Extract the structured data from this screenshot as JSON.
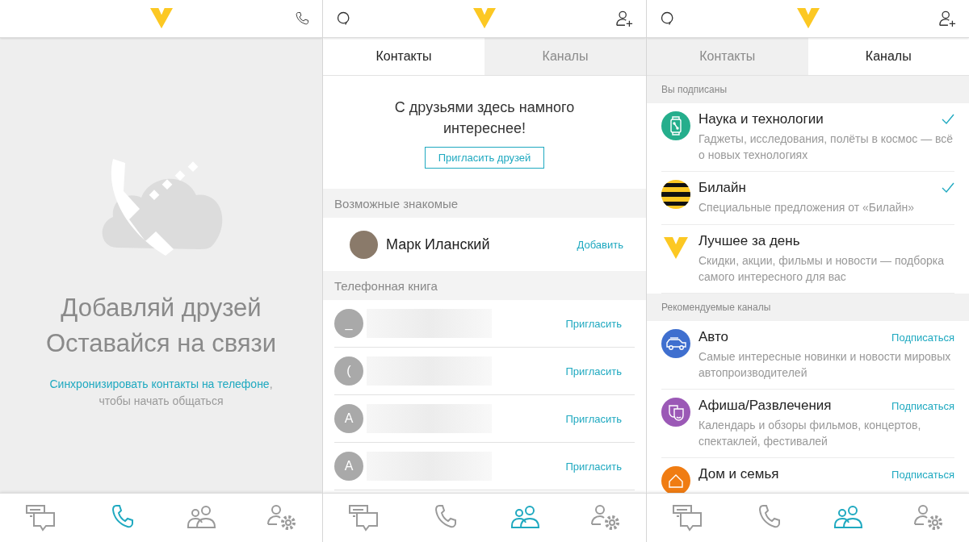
{
  "screens": [
    {
      "kind": "empty",
      "header": {
        "right_actions": [
          {
            "kind": "call"
          }
        ]
      },
      "empty_state": {
        "title_lines": [
          "Добавляй друзей",
          "Оставайся на связи"
        ],
        "link": "Синхронизировать контакты на телефоне",
        "link_suffix": ",",
        "hint": "чтобы начать общаться"
      },
      "nav": [
        {
          "kind": "chats",
          "selected": false
        },
        {
          "kind": "calls",
          "selected": true
        },
        {
          "kind": "contacts",
          "selected": false
        },
        {
          "kind": "settings",
          "selected": false
        }
      ]
    },
    {
      "kind": "contacts",
      "header": {
        "left_actions": [
          {
            "kind": "search"
          }
        ],
        "right_actions": [
          {
            "kind": "add-user"
          }
        ]
      },
      "tabs": [
        {
          "label": "Контакты",
          "selected": true
        },
        {
          "label": "Каналы",
          "selected": false
        }
      ],
      "invite": {
        "text": "С друзьями здесь намного интереснее!",
        "button": "Пригласить друзей"
      },
      "sections": [
        {
          "title": "Возможные знакомые",
          "rows": [
            {
              "kind": "person",
              "name": "Марк Иланский",
              "action": "Добавить"
            }
          ]
        },
        {
          "title": "Телефонная книга",
          "rows": [
            {
              "kind": "phonebook",
              "initial": "_",
              "action": "Пригласить"
            },
            {
              "kind": "phonebook",
              "initial": "(",
              "action": "Пригласить"
            },
            {
              "kind": "phonebook",
              "initial": "A",
              "action": "Пригласить"
            },
            {
              "kind": "phonebook",
              "initial": "A",
              "action": "Пригласить"
            }
          ]
        }
      ],
      "nav": [
        {
          "kind": "chats",
          "selected": false
        },
        {
          "kind": "calls",
          "selected": false
        },
        {
          "kind": "contacts",
          "selected": true
        },
        {
          "kind": "settings",
          "selected": false
        }
      ]
    },
    {
      "kind": "channels",
      "header": {
        "left_actions": [
          {
            "kind": "search"
          }
        ],
        "right_actions": [
          {
            "kind": "add-user"
          }
        ]
      },
      "tabs": [
        {
          "label": "Контакты",
          "selected": false
        },
        {
          "label": "Каналы",
          "selected": true
        }
      ],
      "channel_sections": [
        {
          "title": "Вы подписаны",
          "channels": [
            {
              "kind": "gadget",
              "color": "#25ae8c",
              "title": "Наука и технологии",
              "description": "Гаджеты, исследования, полёты в космос — всё о новых технологиях",
              "subscribed": true
            },
            {
              "kind": "stripes",
              "title": "Билайн",
              "description": "Специальные предложения от «Билайн»",
              "subscribed": true
            },
            {
              "kind": "logo",
              "title": "Лучшее за день",
              "description": "Скидки, акции, фильмы и новости — подборка самого интересного для вас",
              "subscribed": false
            }
          ]
        },
        {
          "title": "Рекомендуемые каналы",
          "channels": [
            {
              "kind": "car",
              "color": "#3f6fcf",
              "title": "Авто",
              "description": "Самые интересные новинки и новости мировых автопроизводителей",
              "subscribed": false,
              "action": "Подписаться"
            },
            {
              "kind": "masks",
              "color": "#9b59b6",
              "title": "Афиша/Развлечения",
              "description": "Календарь и обзоры фильмов, концертов, спектаклей, фестивалей",
              "subscribed": false,
              "action": "Подписаться"
            },
            {
              "kind": "home",
              "color": "#f07c12",
              "title": "Дом и семья",
              "subscribed": false,
              "action": "Подписаться"
            }
          ]
        }
      ],
      "nav": [
        {
          "kind": "chats",
          "selected": false
        },
        {
          "kind": "calls",
          "selected": false
        },
        {
          "kind": "contacts",
          "selected": true
        },
        {
          "kind": "settings",
          "selected": false
        }
      ]
    }
  ]
}
